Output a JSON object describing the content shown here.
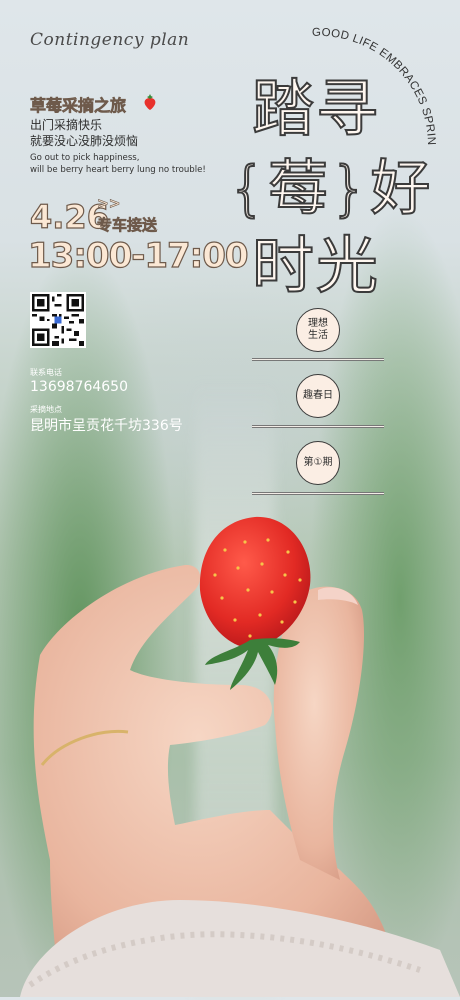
{
  "header": {
    "script_text": "Contingency plan",
    "arc_text": "GOOD LIFE EMBRACES SPRING"
  },
  "headline": {
    "line1": "踏寻",
    "line2": "{莓}好",
    "line3": "时光"
  },
  "event": {
    "title": "草莓采摘之旅",
    "subtitle_lines": [
      "出门采摘快乐",
      "就要没心没肺没烦恼"
    ],
    "english_lines": [
      "Go out to pick happiness,",
      "will be berry heart berry lung no trouble!"
    ],
    "date": "4.26",
    "arrows": ">>",
    "pickup": "专车接送",
    "time": "13:00-17:00"
  },
  "contact": {
    "phone_label": "联系电话",
    "phone": "13698764650",
    "address_label": "采摘地点",
    "address": "昆明市呈贡花千坊336号"
  },
  "badges": {
    "badge1": "理想生活",
    "badge2": "趣春日",
    "badge3": "第①期"
  },
  "colors": {
    "accent": "#fbe8d5",
    "outline": "#3b3b3b",
    "strawberry": "#e8312c"
  }
}
